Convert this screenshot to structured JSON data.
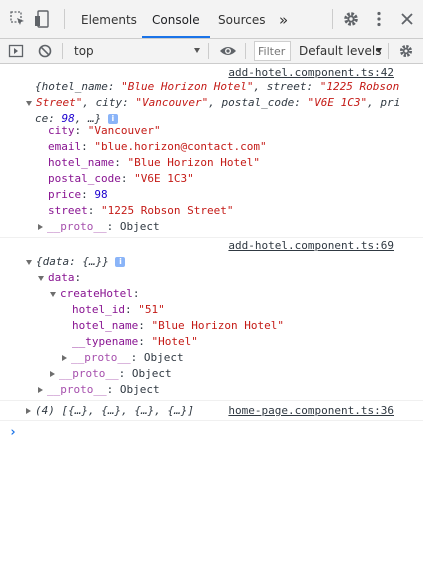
{
  "devtools": {
    "tabs": [
      {
        "label": "Elements",
        "active": false
      },
      {
        "label": "Console",
        "active": true
      },
      {
        "label": "Sources",
        "active": false
      }
    ],
    "more_tabs_label": "»",
    "icons": {
      "inspect": "inspect-element-icon",
      "device": "device-toolbar-icon",
      "settings": "gear-icon",
      "menu": "kebab-menu-icon",
      "close": "close-icon"
    }
  },
  "toolbar": {
    "context": "top",
    "filter_placeholder": "Filter",
    "levels_label": "Default levels"
  },
  "console": {
    "entries": [
      {
        "source": "add-hotel.component.ts:42",
        "preview": {
          "line1_a": "{hotel_name: ",
          "line1_b": "\"Blue Horizon Hotel\"",
          "line1_c": ", street: ",
          "line1_d": "\"1225 Robson",
          "line2_a": "Street\"",
          "line2_b": ", city: ",
          "line2_c": "\"Vancouver\"",
          "line2_d": ", postal_code: ",
          "line2_e": "\"V6E 1C3\"",
          "line2_f": ", pri",
          "line3_a": "ce: ",
          "line3_b": "98",
          "line3_c": ", …}"
        },
        "props": [
          {
            "key": "city",
            "value": "\"Vancouver\"",
            "type": "string"
          },
          {
            "key": "email",
            "value": "\"blue.horizon@contact.com\"",
            "type": "string"
          },
          {
            "key": "hotel_name",
            "value": "\"Blue Horizon Hotel\"",
            "type": "string"
          },
          {
            "key": "postal_code",
            "value": "\"V6E 1C3\"",
            "type": "string"
          },
          {
            "key": "price",
            "value": "98",
            "type": "number"
          },
          {
            "key": "street",
            "value": "\"1225 Robson Street\"",
            "type": "string"
          }
        ],
        "proto": {
          "key": "__proto__",
          "value": "Object"
        }
      },
      {
        "source": "add-hotel.component.ts:69",
        "preview": "{data: {…}}",
        "data_key": "data",
        "createHotel_key": "createHotel",
        "props": [
          {
            "key": "hotel_id",
            "value": "\"51\""
          },
          {
            "key": "hotel_name",
            "value": "\"Blue Horizon Hotel\""
          },
          {
            "key": "__typename",
            "value": "\"Hotel\""
          }
        ],
        "proto_label": "__proto__",
        "proto_value": "Object"
      },
      {
        "source": "home-page.component.ts:36",
        "preview": "(4) [{…}, {…}, {…}, {…}]"
      }
    ],
    "prompt_symbol": "›"
  }
}
